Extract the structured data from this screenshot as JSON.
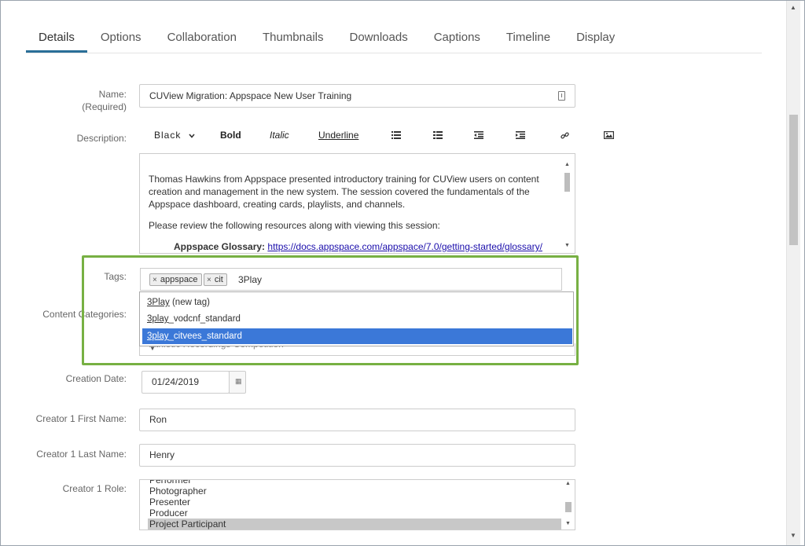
{
  "tabs": [
    {
      "label": "Details",
      "active": true
    },
    {
      "label": "Options"
    },
    {
      "label": "Collaboration"
    },
    {
      "label": "Thumbnails"
    },
    {
      "label": "Downloads"
    },
    {
      "label": "Captions"
    },
    {
      "label": "Timeline"
    },
    {
      "label": "Display"
    }
  ],
  "name": {
    "label": "Name:",
    "required": "(Required)",
    "value": "CUView Migration: Appspace New User Training"
  },
  "description": {
    "label": "Description:",
    "toolbar": {
      "color": "Black",
      "bold": "Bold",
      "italic": "Italic",
      "underline": "Underline"
    },
    "paragraph1": "Thomas Hawkins from Appspace presented introductory training for CUView users on content creation and management in the new system. The session covered the fundamentals of the Appspace dashboard, creating cards, playlists, and channels.",
    "paragraph2": "Please review the following resources along with viewing this session:",
    "bullet_title": "Appspace Glossary:",
    "bullet_link": "https://docs.appspace.com/appspace/7.0/getting-started/glossary/"
  },
  "tags": {
    "label": "Tags:",
    "chips": [
      "appspace",
      "cit"
    ],
    "input_value": "3Play",
    "suggestions": [
      {
        "match": "3Play",
        "rest": " (new tag)"
      },
      {
        "match": "3play",
        "rest": "_vodcnf_standard"
      },
      {
        "match": "3play",
        "rest": "_citvees_standard",
        "selected": true
      }
    ]
  },
  "content_categories": {
    "label": "Content Categories:",
    "partial_value": "Athletic Recordings Competition"
  },
  "creation_date": {
    "label": "Creation Date:",
    "value": "01/24/2019"
  },
  "creator1_first": {
    "label": "Creator 1 First Name:",
    "value": "Ron"
  },
  "creator1_last": {
    "label": "Creator 1 Last Name:",
    "value": "Henry"
  },
  "creator1_role": {
    "label": "Creator 1 Role:",
    "options": [
      "Performer",
      "Photographer",
      "Presenter",
      "Producer",
      "Project Participant"
    ],
    "selected": "Project Participant"
  },
  "colors": {
    "tab_active_underline": "#2a6f98",
    "highlight_border": "#77b043",
    "selection_blue": "#3b78d8"
  }
}
